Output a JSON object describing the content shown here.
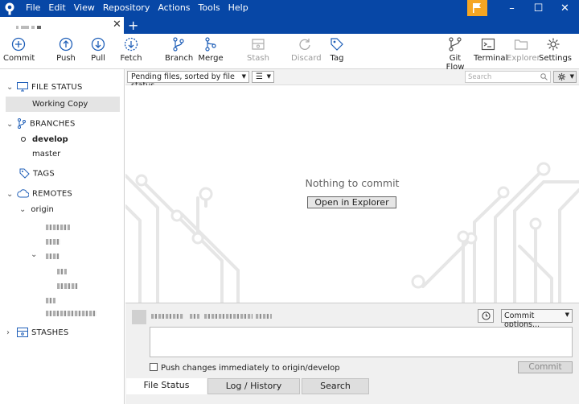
{
  "menu": [
    "File",
    "Edit",
    "View",
    "Repository",
    "Actions",
    "Tools",
    "Help"
  ],
  "window_controls": {
    "minimize": "–",
    "maximize": "☐",
    "close": "✕"
  },
  "tab": {
    "close": "✕",
    "new_tab": "+"
  },
  "toolbar": {
    "commit": "Commit",
    "push": "Push",
    "pull": "Pull",
    "fetch": "Fetch",
    "branch": "Branch",
    "merge": "Merge",
    "stash": "Stash",
    "discard": "Discard",
    "tag": "Tag",
    "git_flow": "Git Flow",
    "terminal": "Terminal",
    "explorer": "Explorer",
    "settings": "Settings"
  },
  "sidebar": {
    "file_status": "FILE STATUS",
    "working_copy": "Working Copy",
    "branches": "BRANCHES",
    "branch_current": "develop",
    "branch_other": "master",
    "tags": "TAGS",
    "remotes": "REMOTES",
    "remote_origin": "origin",
    "stashes": "STASHES"
  },
  "filter": {
    "sort_label": "Pending files, sorted by file status",
    "search_placeholder": "Search"
  },
  "main": {
    "empty_message": "Nothing to commit",
    "open_explorer": "Open in Explorer"
  },
  "commit_area": {
    "options": "Commit options...",
    "push_label": "Push changes immediately to origin/develop",
    "commit_button": "Commit"
  },
  "bottom_tabs": [
    "File Status",
    "Log / History",
    "Search"
  ],
  "colors": {
    "titlebar": "#0747a6",
    "flag": "#f5a623",
    "icon_blue": "#1f5fb8",
    "selection": "#e4e4e4"
  }
}
